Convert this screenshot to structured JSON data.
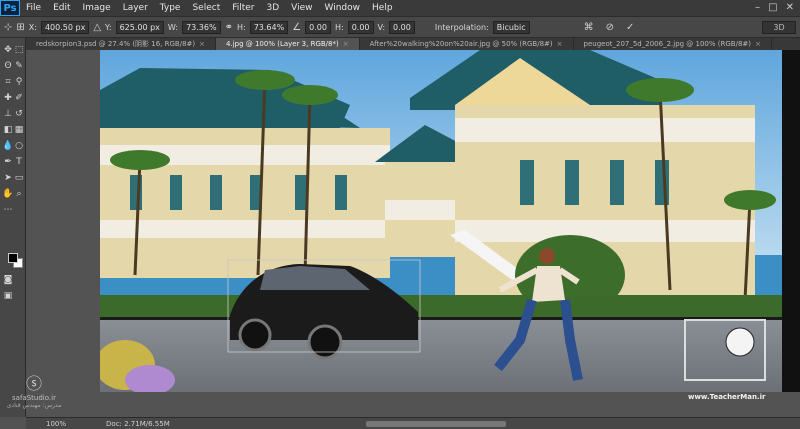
{
  "app": {
    "logo": "Ps"
  },
  "menu": [
    "File",
    "Edit",
    "Image",
    "Layer",
    "Type",
    "Select",
    "Filter",
    "3D",
    "View",
    "Window",
    "Help"
  ],
  "window_controls": [
    "–",
    "□",
    "✕"
  ],
  "options_bar": {
    "x_label": "X:",
    "x_value": "400.50 px",
    "y_label": "Y:",
    "y_value": "625.00 px",
    "w_label": "W:",
    "w_value": "73.36%",
    "h_label": "H:",
    "h_value": "73.64%",
    "rotate_value": "0.00",
    "hskew_label": "H:",
    "hskew_value": "0.00",
    "vskew_label": "V:",
    "vskew_value": "0.00",
    "interp_label": "Interpolation:",
    "interp_value": "Bicubic",
    "workspace": "3D"
  },
  "tabs": [
    {
      "label": "redskorpion3.psd @ 27.4% (阴影 16, RGB/8#)",
      "active": false
    },
    {
      "label": "4.jpg @ 100% (Layer 3, RGB/8*)",
      "active": true
    },
    {
      "label": "After%20walking%20on%20air.jpg @ 50% (RGB/8#)",
      "active": false
    },
    {
      "label": "peugeot_207_5d_2006_2.jpg @ 100% (RGB/8#)",
      "active": false
    }
  ],
  "status": {
    "zoom": "100%",
    "doc": "Doc: 2.71M/6.55M"
  },
  "watermark": {
    "brand": "safaStudio.ir",
    "sub": "مدرس: مهندس قنادی",
    "teacher_url": "www.TeacherMan.ir"
  },
  "colors": {
    "foreground": "#000000",
    "background": "#ffffff",
    "accent": "#2fa3ff"
  }
}
